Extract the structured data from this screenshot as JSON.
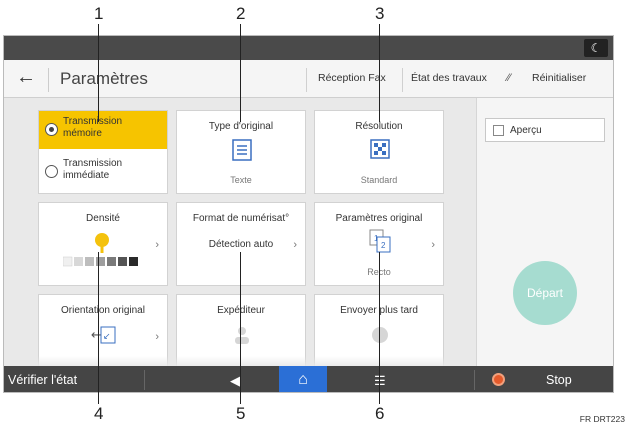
{
  "callouts": [
    "1",
    "2",
    "3",
    "4",
    "5",
    "6"
  ],
  "statusbar": {
    "night_icon": "moon-icon"
  },
  "header": {
    "back_icon": "←",
    "title": "Paramètres",
    "links": [
      "Réception Fax",
      "État des travaux",
      "Réinitialiser"
    ],
    "reset_icon": "⁄⁄"
  },
  "tiles": {
    "transmission": {
      "option1": "Transmission mémoire",
      "option2": "Transmission immédiate",
      "selected": 0
    },
    "type_original": {
      "title": "Type d'original",
      "value": "Texte"
    },
    "resolution": {
      "title": "Résolution",
      "value": "Standard"
    },
    "density": {
      "title": "Densité",
      "level_of_7": 4
    },
    "scan_size": {
      "title": "Format de numérisat°",
      "value": "Détection auto"
    },
    "original_settings": {
      "title": "Paramètres original",
      "value": "Recto"
    },
    "orientation": {
      "title": "Orientation original"
    },
    "sender": {
      "title": "Expéditeur"
    },
    "send_later": {
      "title": "Envoyer plus tard"
    }
  },
  "right_panel": {
    "preview_label": "Aperçu",
    "start_label": "Départ"
  },
  "bottombar": {
    "check_status": "Vérifier l'état",
    "stop": "Stop"
  },
  "footnote": "FR DRT223",
  "colors": {
    "selected": "#f6c400",
    "home": "#2b6fd6",
    "start": "#a6dcd0",
    "stop": "#e55a2b"
  }
}
